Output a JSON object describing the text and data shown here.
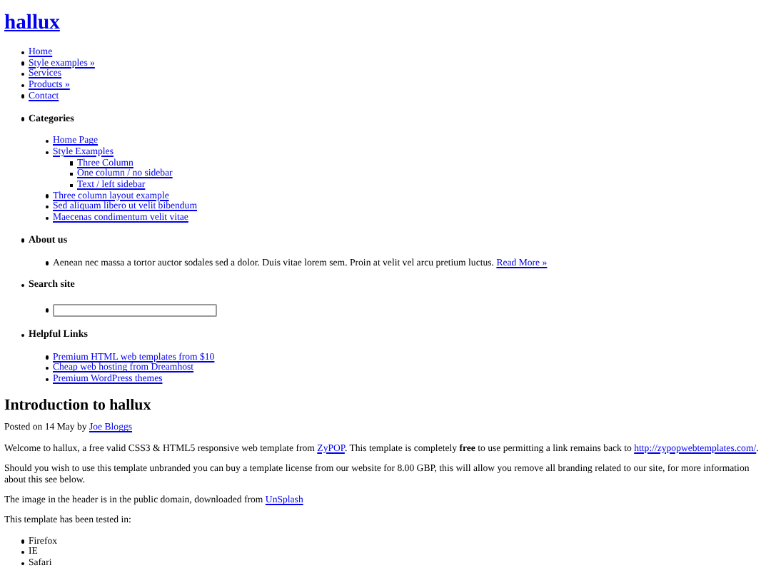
{
  "site_title": "hallux",
  "nav": [
    {
      "label": "Home"
    },
    {
      "label": "Style examples »"
    },
    {
      "label": "Services"
    },
    {
      "label": "Products »"
    },
    {
      "label": "Contact"
    }
  ],
  "widgets": [
    {
      "title": "Categories",
      "kind": "links",
      "items": [
        {
          "label": "Home Page"
        },
        {
          "label": "Style Examples",
          "children": [
            {
              "label": "Three Column"
            },
            {
              "label": "One column / no sidebar"
            },
            {
              "label": "Text / left sidebar"
            }
          ]
        },
        {
          "label": "Three column layout example"
        },
        {
          "label": "Sed aliquam libero ut velit bibendum"
        },
        {
          "label": "Maecenas condimentum velit vitae"
        }
      ]
    },
    {
      "title": "About us",
      "kind": "text",
      "text": "Aenean nec massa a tortor auctor sodales sed a dolor. Duis vitae lorem sem. Proin at velit vel arcu pretium luctus.",
      "link": "Read More »"
    },
    {
      "title": "Search site",
      "kind": "search"
    },
    {
      "title": "Helpful Links",
      "kind": "links",
      "items": [
        {
          "label": "Premium HTML web templates from $10"
        },
        {
          "label": "Cheap web hosting from Dreamhost"
        },
        {
          "label": "Premium WordPress themes"
        }
      ]
    }
  ],
  "article": {
    "title": "Introduction to hallux",
    "byline": [
      {
        "kind": "text",
        "text": "Posted on 14 May by "
      },
      {
        "kind": "link",
        "text": "Joe Bloggs"
      }
    ],
    "paragraphs": [
      [
        {
          "kind": "text",
          "text": "Welcome to hallux, a free valid CSS3 & HTML5 responsive web template from "
        },
        {
          "kind": "link",
          "text": "ZyPOP"
        },
        {
          "kind": "text",
          "text": ". This template is completely **free** to use permitting a link remains back to "
        },
        {
          "kind": "link",
          "text": "http://zypopwebtemplates.com/"
        },
        {
          "kind": "text",
          "text": "."
        }
      ],
      [
        {
          "kind": "text",
          "text": "Should you wish to use this template unbranded you can buy a template license from our website for 8.00 GBP, this will allow you remove all branding related to our site, for more information about this see below."
        }
      ],
      [
        {
          "kind": "text",
          "text": "The image in the header is in the public domain, downloaded from "
        },
        {
          "kind": "link",
          "text": "UnSplash"
        }
      ],
      [
        {
          "kind": "text",
          "text": "This template has been tested in:"
        }
      ]
    ],
    "list": [
      "Firefox",
      "IE",
      "Safari"
    ]
  }
}
